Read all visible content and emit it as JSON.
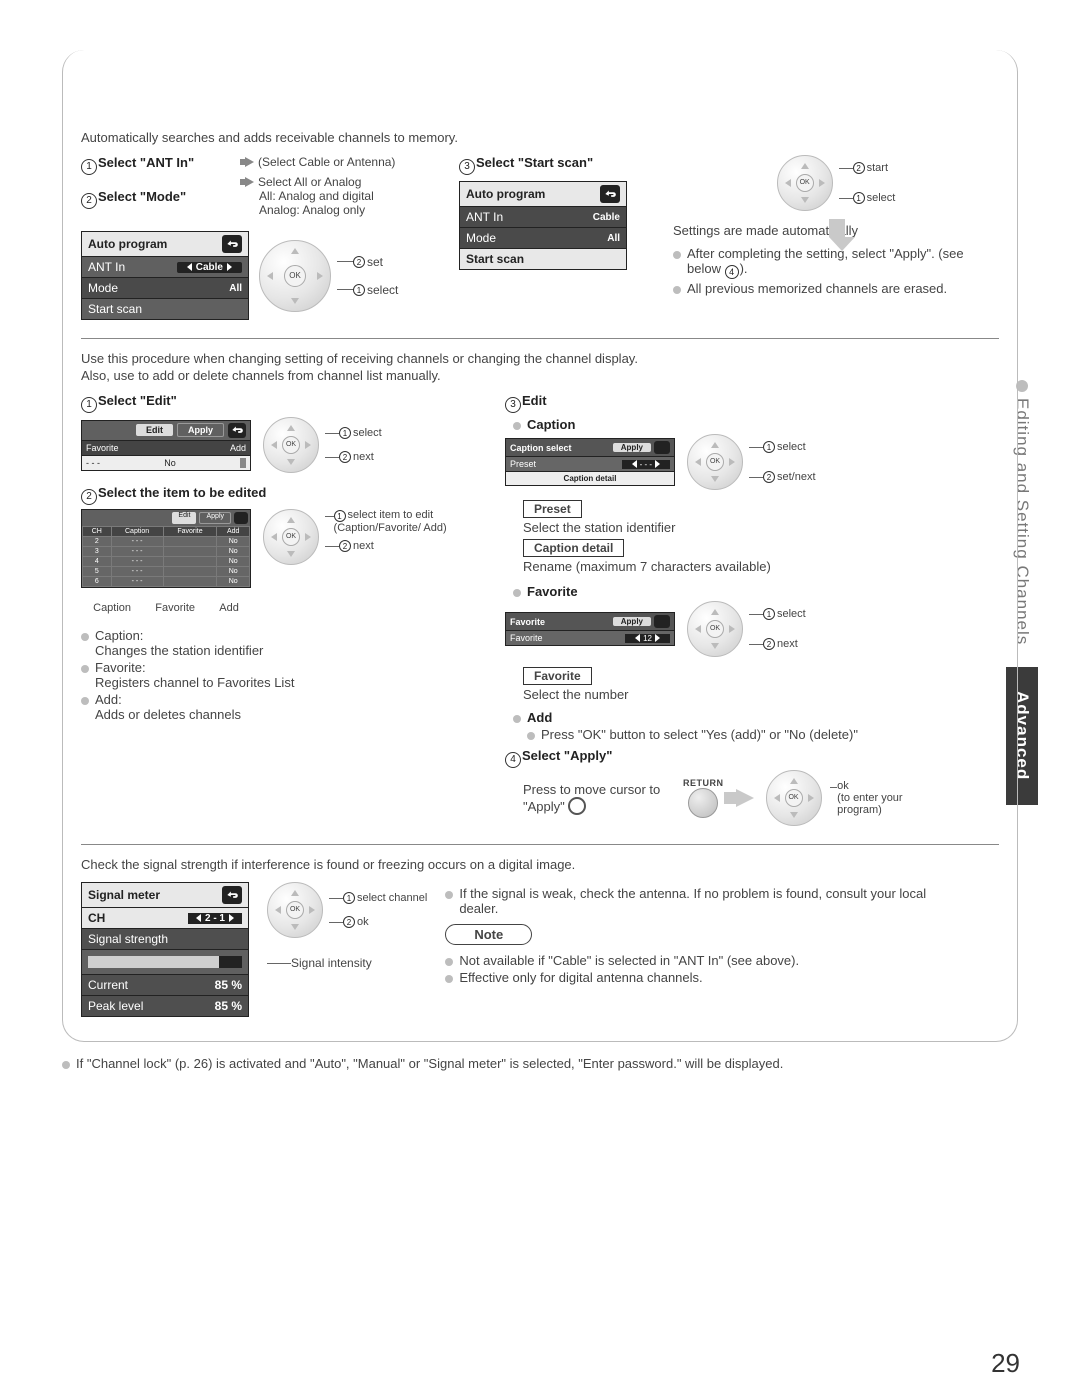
{
  "page_number": "29",
  "side_tab_grey": "Editing and Setting Channels",
  "side_tab_dark": "Advanced",
  "auto": {
    "intro": "Automatically searches and adds receivable channels to memory.",
    "step1_title": "Select \"ANT In\"",
    "step1_note": "(Select Cable or Antenna)",
    "step2_title": "Select \"Mode\"",
    "step2_note1": "Select All or Analog",
    "step2_note2": "All: Analog and digital",
    "step2_note3": "Analog: Analog only",
    "step3_title": "Select \"Start scan\"",
    "menu_title": "Auto program",
    "row_ant": "ANT In",
    "val_cable": "Cable",
    "row_mode": "Mode",
    "val_all": "All",
    "row_start": "Start scan",
    "pad_set": "set",
    "pad_select": "select",
    "pad_start": "start",
    "auto_msg": "Settings are made automatically",
    "bullet1a": "After completing the setting, select \"Apply\". (see below ",
    "bullet1b": ").",
    "bullet2": "All previous memorized channels are erased."
  },
  "manual": {
    "intro1": "Use this procedure when changing setting of receiving channels or changing the channel display.",
    "intro2": "Also, use to add or delete channels from channel list manually.",
    "s1_title": "Select \"Edit\"",
    "edit_tab": "Edit",
    "apply_tab": "Apply",
    "fav_lbl": "Favorite",
    "add_lbl": "Add",
    "dash": "- - -",
    "no": "No",
    "pad_select": "select",
    "pad_next": "next",
    "s2_title": "Select the item to be edited",
    "t_ch": "CH",
    "t_cap": "Caption",
    "t_fav": "Favorite",
    "t_add": "Add",
    "t_r1": "2",
    "t_r2": "3",
    "t_r3": "4",
    "t_r4": "5",
    "t_r5": "6",
    "t_dots": "- - -",
    "t_no": "No",
    "call_cap": "Caption",
    "call_fav": "Favorite",
    "call_add": "Add",
    "pad_selitem": "select item to edit (Caption/Favorite/ Add)",
    "b_cap_t": "Caption:",
    "b_cap_d": "Changes the station identifier",
    "b_fav_t": "Favorite:",
    "b_fav_d": "Registers channel to Favorites List",
    "b_add_t": "Add:",
    "b_add_d": "Adds or deletes channels",
    "s3_title": "Edit",
    "cap_h": "Caption",
    "cap_menu_t": "Caption select",
    "cap_apply": "Apply",
    "cap_preset": "Preset",
    "cap_dashes": "- - -",
    "cap_detail": "Caption detail",
    "pad_setnext": "set/next",
    "preset_box": "Preset",
    "preset_desc": "Select the station identifier",
    "capdet_box": "Caption detail",
    "capdet_desc": "Rename (maximum 7 characters available)",
    "fav_h": "Favorite",
    "fav_menu_t": "Favorite",
    "fav_row": "Favorite",
    "fav_val": "12",
    "fav_box": "Favorite",
    "fav_desc": "Select the number",
    "add_h": "Add",
    "add_desc": "Press \"OK\" button to select \"Yes (add)\" or \"No (delete)\"",
    "s4_title": "Select \"Apply\"",
    "s4_desc": "Press to move cursor to \"Apply\"",
    "return_lbl": "RETURN",
    "ok_desc1": "ok",
    "ok_desc2": "(to enter your program)"
  },
  "signal": {
    "intro": "Check the signal strength if interference is found or freezing occurs on a digital image.",
    "menu_t": "Signal meter",
    "ch": "CH",
    "ch_val": "2 - 1",
    "strength": "Signal strength",
    "current": "Current",
    "cur_v": "85 %",
    "peak": "Peak level",
    "peak_v": "85 %",
    "pad_sel": "select channel",
    "pad_ok": "ok",
    "sig_int": "Signal intensity",
    "r1": "If the signal is weak, check the antenna. If no problem is found, consult your local dealer.",
    "note": "Note",
    "n1": "Not available if \"Cable\" is selected in \"ANT In\" (see above).",
    "n2": "Effective only for digital antenna channels."
  },
  "footer": "If \"Channel lock\" (p. 26) is activated and \"Auto\", \"Manual\" or \"Signal meter\" is selected, \"Enter password.\" will be displayed."
}
